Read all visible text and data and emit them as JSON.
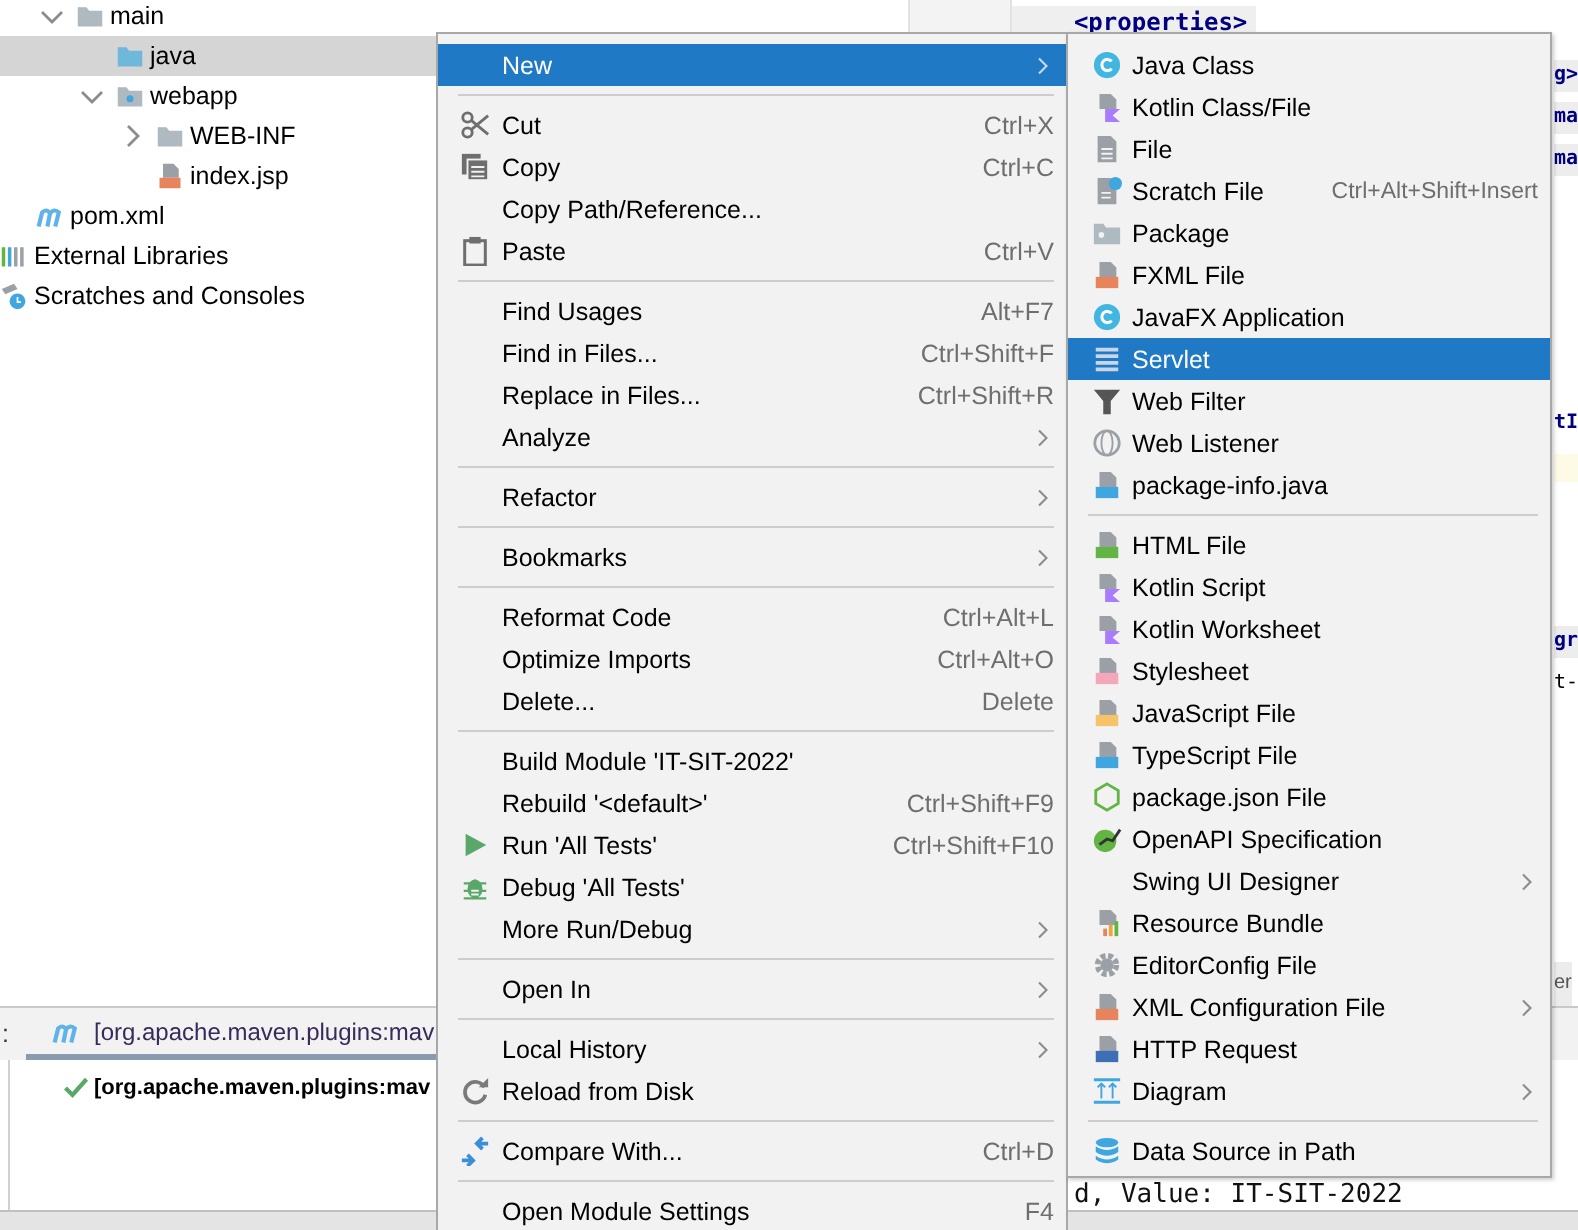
{
  "project_tree": {
    "items": [
      {
        "label": "main",
        "kind": "folder",
        "expanded": true,
        "selected": false,
        "children": [
          {
            "label": "java",
            "kind": "source-folder",
            "selected": true
          },
          {
            "label": "webapp",
            "kind": "web-folder",
            "expanded": true,
            "selected": false,
            "children": [
              {
                "label": "WEB-INF",
                "kind": "folder",
                "expanded": false,
                "selected": false
              },
              {
                "label": "index.jsp",
                "kind": "jsp-file",
                "selected": false
              }
            ]
          }
        ]
      },
      {
        "label": "pom.xml",
        "kind": "maven-file",
        "selected": false
      },
      {
        "label": "External Libraries",
        "kind": "libraries",
        "selected": false
      },
      {
        "label": "Scratches and Consoles",
        "kind": "scratches",
        "selected": false
      }
    ]
  },
  "editor": {
    "fragments": [
      {
        "text": "<properties>",
        "kind": "tag"
      },
      {
        "text": "g>",
        "kind": "tag-end"
      },
      {
        "text": "ma",
        "kind": "shaded"
      },
      {
        "text": "ma",
        "kind": "shaded"
      },
      {
        "text": "tI",
        "kind": "ident"
      },
      {
        "kind": "current-line"
      },
      {
        "text": "gr",
        "kind": "shaded"
      },
      {
        "text": "t-",
        "kind": "plain"
      },
      {
        "text": "er",
        "kind": "tab-label"
      }
    ]
  },
  "run_panel": {
    "strip_label": ":",
    "tabs": [
      {
        "label": "[org.apache.maven.plugins:mav",
        "selected": true
      }
    ],
    "tree": [
      {
        "label": "[org.apache.maven.plugins:mav",
        "passed": true
      }
    ],
    "console_line": "d, Value: IT-SIT-2022"
  },
  "context_menu": {
    "items": [
      {
        "kind": "item",
        "label": "New",
        "submenu": true,
        "selected": true
      },
      {
        "kind": "separator"
      },
      {
        "kind": "item",
        "label": "Cut",
        "shortcut": "Ctrl+X",
        "selected": false
      },
      {
        "kind": "item",
        "label": "Copy",
        "shortcut": "Ctrl+C",
        "selected": false
      },
      {
        "kind": "item",
        "label": "Copy Path/Reference...",
        "selected": false
      },
      {
        "kind": "item",
        "label": "Paste",
        "shortcut": "Ctrl+V",
        "selected": false
      },
      {
        "kind": "separator"
      },
      {
        "kind": "item",
        "label": "Find Usages",
        "shortcut": "Alt+F7",
        "selected": false
      },
      {
        "kind": "item",
        "label": "Find in Files...",
        "shortcut": "Ctrl+Shift+F",
        "selected": false
      },
      {
        "kind": "item",
        "label": "Replace in Files...",
        "shortcut": "Ctrl+Shift+R",
        "selected": false
      },
      {
        "kind": "item",
        "label": "Analyze",
        "submenu": true,
        "selected": false
      },
      {
        "kind": "separator"
      },
      {
        "kind": "item",
        "label": "Refactor",
        "submenu": true,
        "selected": false
      },
      {
        "kind": "separator"
      },
      {
        "kind": "item",
        "label": "Bookmarks",
        "submenu": true,
        "selected": false
      },
      {
        "kind": "separator"
      },
      {
        "kind": "item",
        "label": "Reformat Code",
        "shortcut": "Ctrl+Alt+L",
        "selected": false
      },
      {
        "kind": "item",
        "label": "Optimize Imports",
        "shortcut": "Ctrl+Alt+O",
        "selected": false
      },
      {
        "kind": "item",
        "label": "Delete...",
        "shortcut": "Delete",
        "selected": false
      },
      {
        "kind": "separator"
      },
      {
        "kind": "item",
        "label": "Build Module 'IT-SIT-2022'",
        "selected": false
      },
      {
        "kind": "item",
        "label": "Rebuild '<default>'",
        "shortcut": "Ctrl+Shift+F9",
        "selected": false
      },
      {
        "kind": "item",
        "label": "Run 'All Tests'",
        "shortcut": "Ctrl+Shift+F10",
        "selected": false
      },
      {
        "kind": "item",
        "label": "Debug 'All Tests'",
        "selected": false
      },
      {
        "kind": "item",
        "label": "More Run/Debug",
        "submenu": true,
        "selected": false
      },
      {
        "kind": "separator"
      },
      {
        "kind": "item",
        "label": "Open In",
        "submenu": true,
        "selected": false
      },
      {
        "kind": "separator"
      },
      {
        "kind": "item",
        "label": "Local History",
        "submenu": true,
        "selected": false
      },
      {
        "kind": "item",
        "label": "Reload from Disk",
        "selected": false
      },
      {
        "kind": "separator"
      },
      {
        "kind": "item",
        "label": "Compare With...",
        "shortcut": "Ctrl+D",
        "selected": false
      },
      {
        "kind": "separator"
      },
      {
        "kind": "item",
        "label": "Open Module Settings",
        "shortcut": "F4",
        "selected": false
      }
    ]
  },
  "new_submenu": {
    "items": [
      {
        "kind": "item",
        "label": "Java Class",
        "selected": false
      },
      {
        "kind": "item",
        "label": "Kotlin Class/File",
        "selected": false
      },
      {
        "kind": "item",
        "label": "File",
        "selected": false
      },
      {
        "kind": "item",
        "label": "Scratch File",
        "shortcut": "Ctrl+Alt+Shift+Insert",
        "selected": false
      },
      {
        "kind": "item",
        "label": "Package",
        "selected": false
      },
      {
        "kind": "item",
        "label": "FXML File",
        "selected": false
      },
      {
        "kind": "item",
        "label": "JavaFX Application",
        "selected": false
      },
      {
        "kind": "item",
        "label": "Servlet",
        "selected": true
      },
      {
        "kind": "item",
        "label": "Web Filter",
        "selected": false
      },
      {
        "kind": "item",
        "label": "Web Listener",
        "selected": false
      },
      {
        "kind": "item",
        "label": "package-info.java",
        "selected": false
      },
      {
        "kind": "separator"
      },
      {
        "kind": "item",
        "label": "HTML File",
        "selected": false
      },
      {
        "kind": "item",
        "label": "Kotlin Script",
        "selected": false
      },
      {
        "kind": "item",
        "label": "Kotlin Worksheet",
        "selected": false
      },
      {
        "kind": "item",
        "label": "Stylesheet",
        "selected": false
      },
      {
        "kind": "item",
        "label": "JavaScript File",
        "selected": false
      },
      {
        "kind": "item",
        "label": "TypeScript File",
        "selected": false
      },
      {
        "kind": "item",
        "label": "package.json File",
        "selected": false
      },
      {
        "kind": "item",
        "label": "OpenAPI Specification",
        "selected": false
      },
      {
        "kind": "item",
        "label": "Swing UI Designer",
        "submenu": true,
        "selected": false
      },
      {
        "kind": "item",
        "label": "Resource Bundle",
        "selected": false
      },
      {
        "kind": "item",
        "label": "EditorConfig File",
        "selected": false
      },
      {
        "kind": "item",
        "label": "XML Configuration File",
        "submenu": true,
        "selected": false
      },
      {
        "kind": "item",
        "label": "HTTP Request",
        "selected": false
      },
      {
        "kind": "item",
        "label": "Diagram",
        "submenu": true,
        "selected": false
      },
      {
        "kind": "separator"
      },
      {
        "kind": "item",
        "label": "Data Source in Path",
        "selected": false
      }
    ]
  }
}
